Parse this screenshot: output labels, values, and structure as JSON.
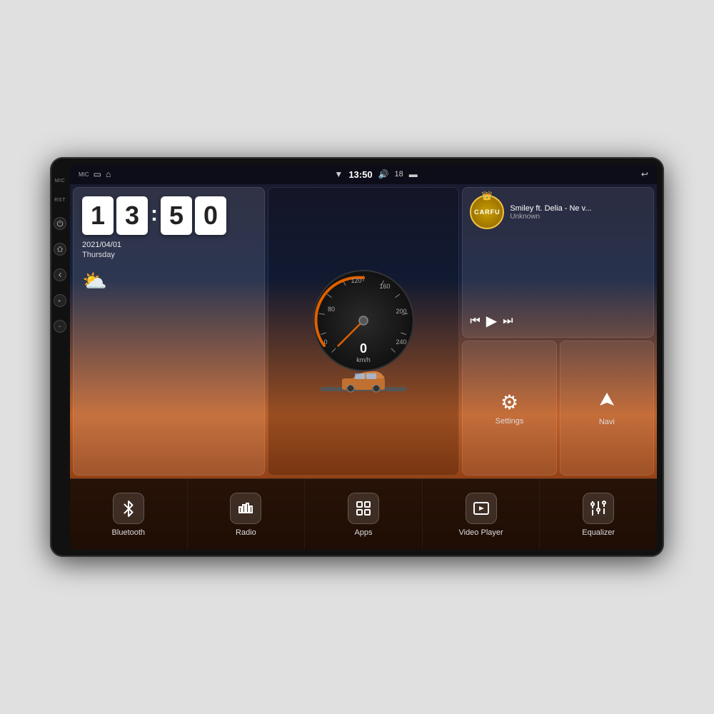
{
  "device": {
    "label": "Car Android Head Unit"
  },
  "statusBar": {
    "mic": "MIC",
    "time": "13:50",
    "volume": "18",
    "wifi_icon": "wifi",
    "back_label": "back"
  },
  "clock": {
    "hour1": "1",
    "hour2": "3",
    "minute1": "5",
    "minute2": "0",
    "date": "2021/04/01",
    "day": "Thursday",
    "weather_emoji": "⛅"
  },
  "music": {
    "title": "Smiley ft. Delia - Ne v...",
    "artist": "Unknown",
    "logo_text": "CARFU",
    "crown": "👑"
  },
  "speedometer": {
    "value": "0",
    "unit": "km/h",
    "max": "240"
  },
  "widgets": {
    "settings_label": "Settings",
    "navi_label": "Navi"
  },
  "bottomBar": {
    "items": [
      {
        "id": "bluetooth",
        "label": "Bluetooth"
      },
      {
        "id": "radio",
        "label": "Radio"
      },
      {
        "id": "apps",
        "label": "Apps"
      },
      {
        "id": "video-player",
        "label": "Video Player"
      },
      {
        "id": "equalizer",
        "label": "Equalizer"
      }
    ]
  },
  "sideButtons": [
    {
      "id": "power",
      "symbol": "⏻"
    },
    {
      "id": "home",
      "symbol": "⌂"
    },
    {
      "id": "back",
      "symbol": "↺"
    },
    {
      "id": "vol-up",
      "symbol": "+"
    },
    {
      "id": "vol-down",
      "symbol": "−"
    }
  ]
}
